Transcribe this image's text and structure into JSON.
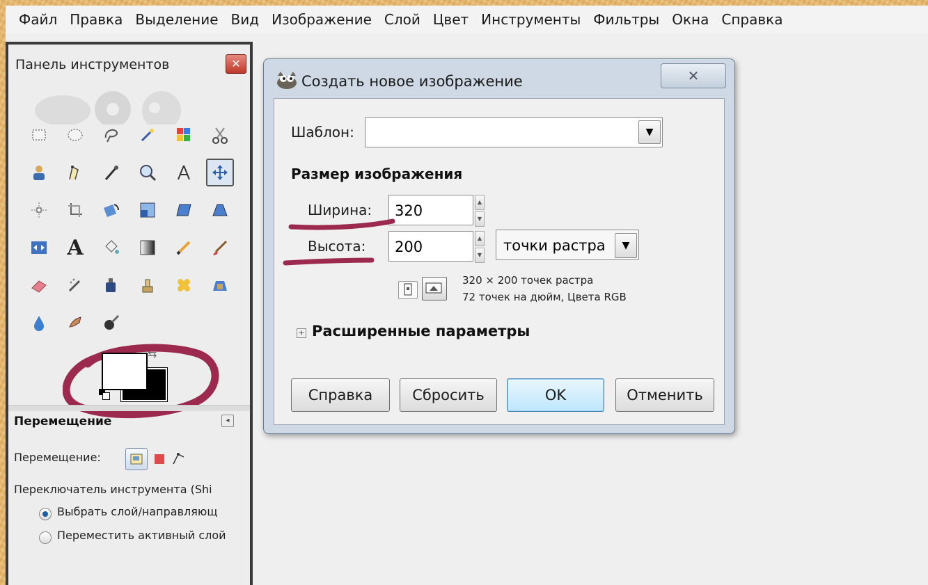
{
  "menubar": {
    "items": [
      "Файл",
      "Правка",
      "Выделение",
      "Вид",
      "Изображение",
      "Слой",
      "Цвет",
      "Инструменты",
      "Фильтры",
      "Окна",
      "Справка"
    ]
  },
  "toolbox": {
    "title": "Панель инструментов",
    "close_icon": "close-icon",
    "tools": [
      "rect-select-icon",
      "ellipse-select-icon",
      "free-select-icon",
      "fuzzy-select-icon",
      "select-by-color-icon",
      "scissors-icon",
      "foreground-select-icon",
      "paths-icon",
      "color-picker-icon",
      "zoom-icon",
      "measure-icon",
      "move-icon",
      "align-icon",
      "crop-icon",
      "rotate-icon",
      "scale-icon",
      "shear-icon",
      "perspective-icon",
      "flip-icon",
      "text-icon",
      "bucket-fill-icon",
      "blend-icon",
      "pencil-icon",
      "paintbrush-icon",
      "eraser-icon",
      "airbrush-icon",
      "ink-icon",
      "clone-icon",
      "heal-icon",
      "perspective-clone-icon",
      "blur-icon",
      "smudge-icon",
      "dodge-burn-icon"
    ],
    "active_tool": "move-icon",
    "colors": {
      "foreground": "#ffffff",
      "background": "#000000"
    },
    "options": {
      "title": "Перемещение",
      "move_label": "Перемещение:",
      "switch_label": "Переключатель инструмента  (Shi",
      "radio_pick": "Выбрать слой/направляющ",
      "radio_move_active": "Переместить активный слой"
    }
  },
  "dialog": {
    "title": "Создать новое изображение",
    "template_label": "Шаблон:",
    "template_value": "",
    "size_section": "Размер изображения",
    "width_label": "Ширина:",
    "width_value": "320",
    "height_label": "Высота:",
    "height_value": "200",
    "unit": "точки растра",
    "info_line1": "320 × 200 точек растра",
    "info_line2": "72 точек на дюйм, Цвета RGB",
    "advanced": "Расширенные параметры",
    "buttons": {
      "help": "Справка",
      "reset": "Сбросить",
      "ok": "OK",
      "cancel": "Отменить"
    }
  },
  "colors": {
    "annotation": "#9c2a4e",
    "page_bg": "#e6b66b",
    "ok_border": "#3c7fb1"
  }
}
